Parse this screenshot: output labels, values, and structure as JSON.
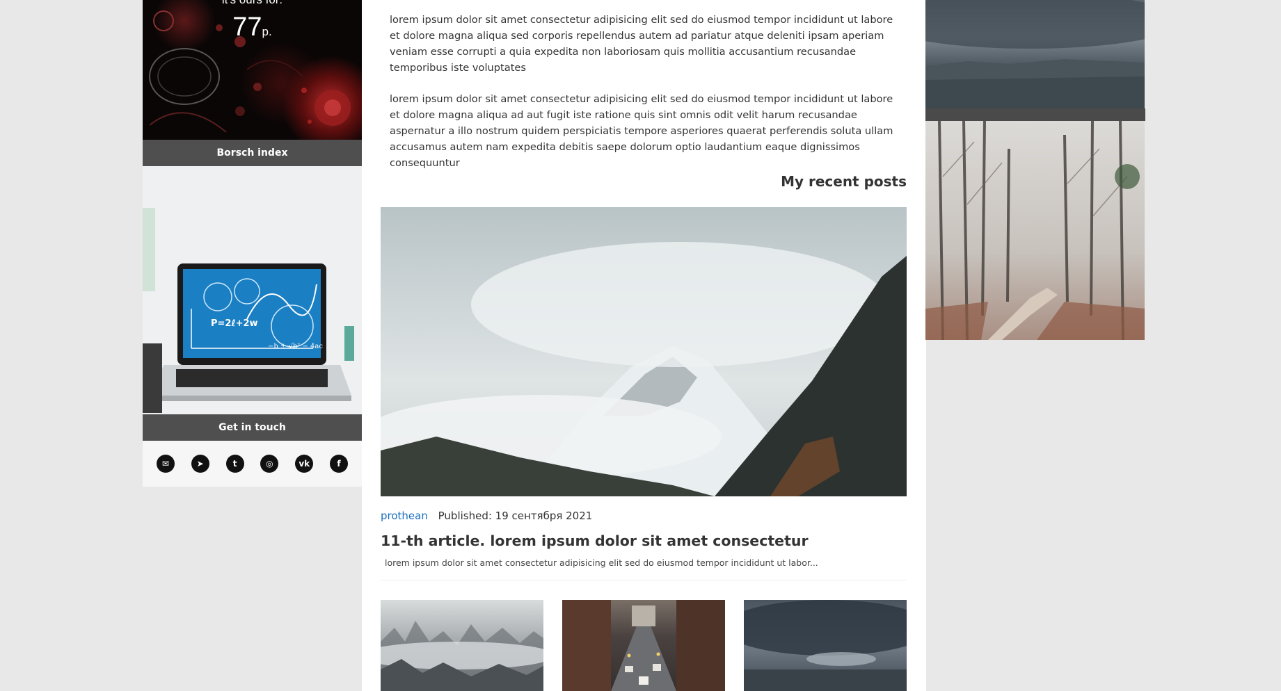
{
  "left_sidebar": {
    "borsch": {
      "caption": "it's ours for:",
      "price_value": "77",
      "price_unit": "p.",
      "bar_label": "Borsch index"
    },
    "contact": {
      "bar_label": "Get in touch",
      "icons": [
        "email-icon",
        "telegram-icon",
        "twitter-icon",
        "instagram-icon",
        "vk-icon",
        "facebook-icon"
      ],
      "icon_glyphs": {
        "email": "✉",
        "telegram": "➤",
        "twitter": "t",
        "instagram": "◎",
        "vk": "vk",
        "facebook": "f"
      }
    }
  },
  "main": {
    "paragraphs": [
      "lorem ipsum dolor sit amet consectetur adipisicing elit sed do eiusmod tempor incididunt ut labore et dolore magna aliqua sed corporis repellendus autem ad pariatur atque deleniti ipsam aperiam veniam esse corrupti a quia expedita non laboriosam quis mollitia accusantium recusandae temporibus iste voluptates",
      "lorem ipsum dolor sit amet consectetur adipisicing elit sed do eiusmod tempor incididunt ut labore et dolore magna aliqua ad aut fugit iste ratione quis sint omnis odit velit harum recusandae aspernatur a illo nostrum quidem perspiciatis tempore asperiores quaerat perferendis soluta ullam accusamus autem nam expedita debitis saepe dolorum optio laudantium eaque dignissimos consequuntur"
    ],
    "recent_title": "My recent posts",
    "featured_post": {
      "author": "prothean",
      "published": "Published: 19 сентября 2021",
      "title": "11-th article. lorem ipsum dolor sit amet consectetur",
      "excerpt": "lorem ipsum dolor sit amet consectetur adipisicing elit sed do eiusmod tempor incididunt ut labor..."
    }
  },
  "colors": {
    "page_bg": "#e8e8e8",
    "content_bg": "#ffffff",
    "bar_bg": "#4f4f4f",
    "link": "#1a6fc0",
    "text": "#333333"
  }
}
